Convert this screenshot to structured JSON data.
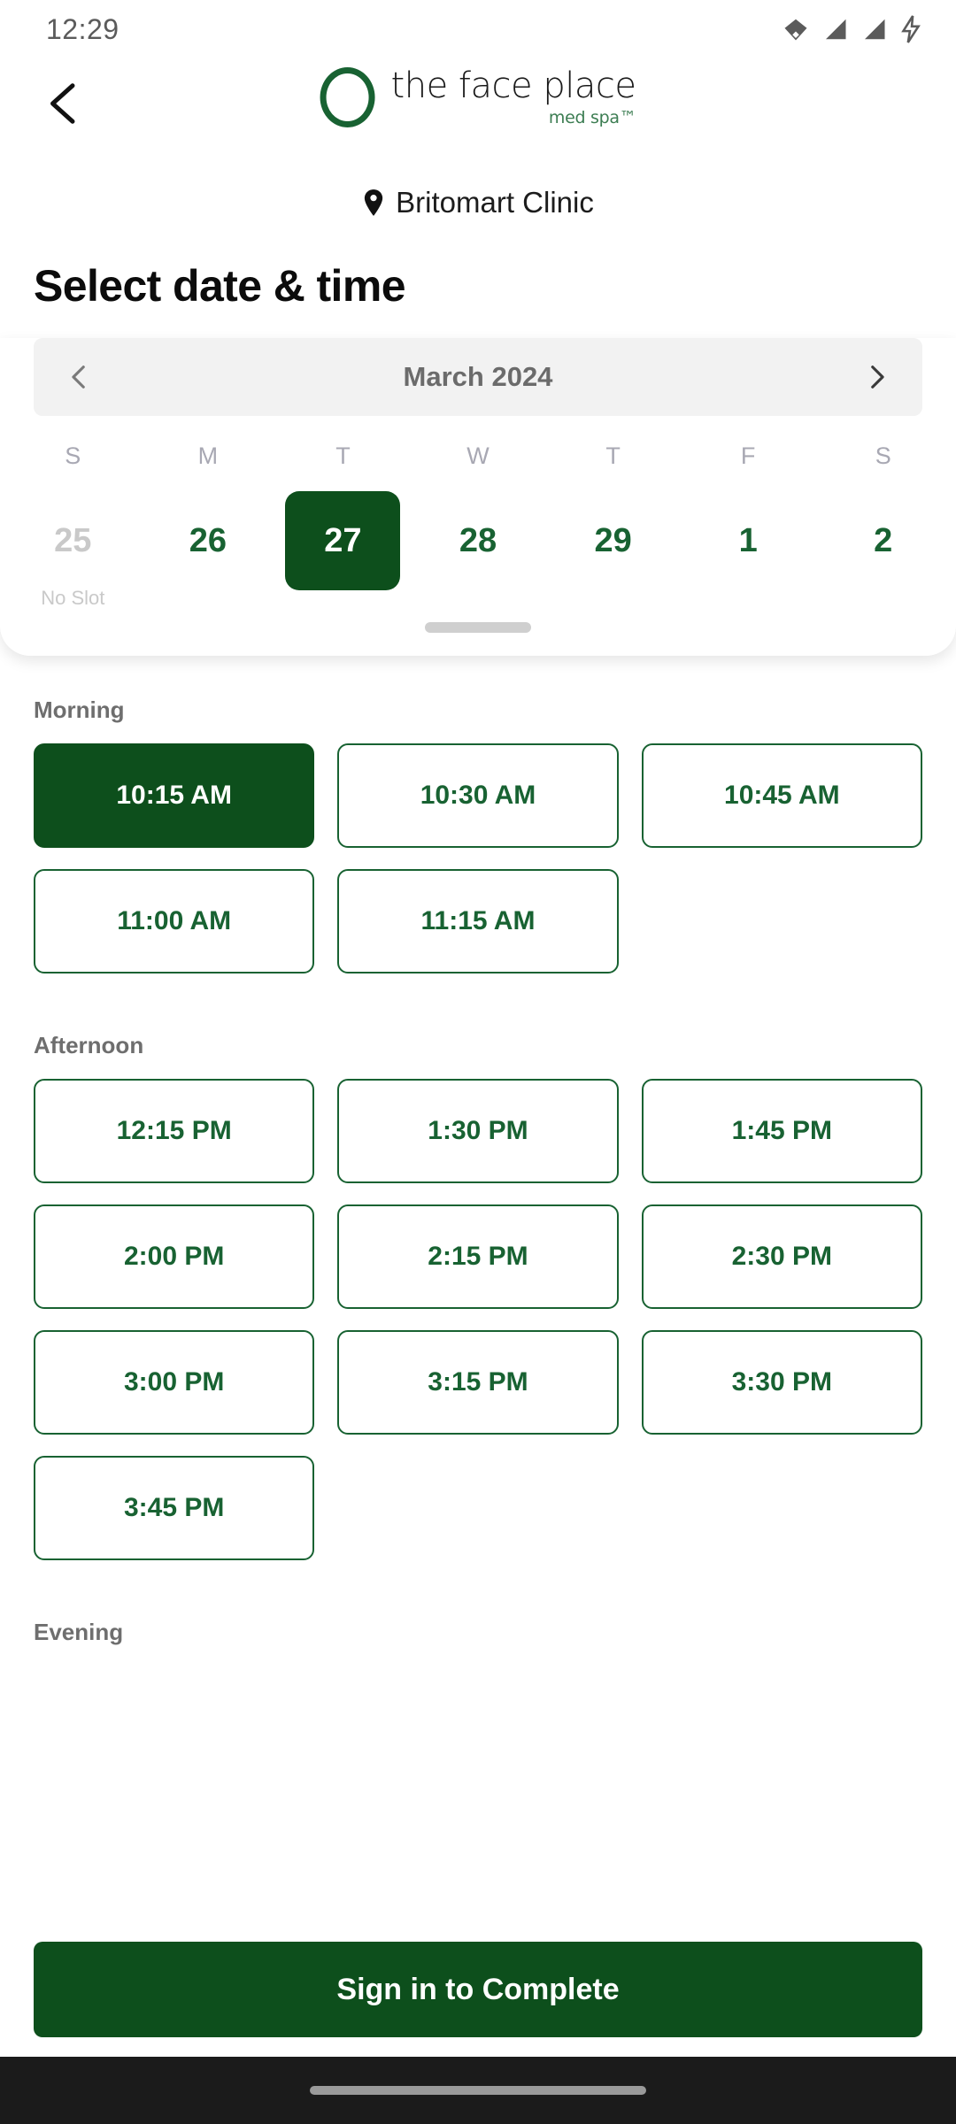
{
  "status_bar": {
    "time": "12:29",
    "icons": [
      "wifi-icon",
      "signal-icon",
      "signal-icon",
      "charging-bolt-icon"
    ]
  },
  "header": {
    "back_icon": "chevron-left-icon",
    "brand_name": "the face place",
    "brand_sub": "med spa™",
    "logo_icon": "ring-logo-icon"
  },
  "clinic": {
    "pin_icon": "location-pin-icon",
    "name": "Britomart Clinic"
  },
  "page": {
    "title": "Select date & time"
  },
  "calendar": {
    "prev_icon": "chevron-left-icon",
    "next_icon": "chevron-right-icon",
    "month_label": "March 2024",
    "weekdays": [
      "S",
      "M",
      "T",
      "W",
      "T",
      "F",
      "S"
    ],
    "dates": [
      {
        "day": "25",
        "note": "No Slot",
        "state": "disabled"
      },
      {
        "day": "26",
        "note": "",
        "state": "available"
      },
      {
        "day": "27",
        "note": "",
        "state": "selected"
      },
      {
        "day": "28",
        "note": "",
        "state": "available"
      },
      {
        "day": "29",
        "note": "",
        "state": "available"
      },
      {
        "day": "1",
        "note": "",
        "state": "available"
      },
      {
        "day": "2",
        "note": "",
        "state": "available"
      }
    ]
  },
  "slot_sections": [
    {
      "label": "Morning",
      "slots": [
        {
          "time": "10:15 AM",
          "state": "selected"
        },
        {
          "time": "10:30 AM",
          "state": "available"
        },
        {
          "time": "10:45 AM",
          "state": "available"
        },
        {
          "time": "11:00 AM",
          "state": "available"
        },
        {
          "time": "11:15 AM",
          "state": "available"
        }
      ]
    },
    {
      "label": "Afternoon",
      "slots": [
        {
          "time": "12:15 PM",
          "state": "available"
        },
        {
          "time": "1:30 PM",
          "state": "available"
        },
        {
          "time": "1:45 PM",
          "state": "available"
        },
        {
          "time": "2:00 PM",
          "state": "available"
        },
        {
          "time": "2:15 PM",
          "state": "available"
        },
        {
          "time": "2:30 PM",
          "state": "available"
        },
        {
          "time": "3:00 PM",
          "state": "available"
        },
        {
          "time": "3:15 PM",
          "state": "available"
        },
        {
          "time": "3:30 PM",
          "state": "available"
        },
        {
          "time": "3:45 PM",
          "state": "available"
        }
      ]
    },
    {
      "label": "Evening",
      "slots": []
    }
  ],
  "cta": {
    "label": "Sign in to Complete"
  },
  "colors": {
    "brand_green": "#186232",
    "selected_green": "#0d4f1c",
    "muted": "#a8a8b3",
    "chip_bg": "#f2f2f2"
  }
}
